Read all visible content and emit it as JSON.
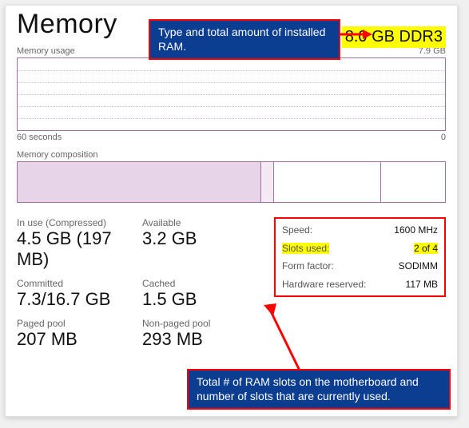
{
  "title": "Memory",
  "total_mem": "8.0 GB DDR3",
  "usage": {
    "label": "Memory usage",
    "max_label": "7.9 GB",
    "axis_left": "60 seconds",
    "axis_right": "0"
  },
  "composition": {
    "label": "Memory composition"
  },
  "stats": {
    "inuse_label": "In use (Compressed)",
    "inuse_value": "4.5 GB (197 MB)",
    "avail_label": "Available",
    "avail_value": "3.2 GB",
    "committed_label": "Committed",
    "committed_value": "7.3/16.7 GB",
    "cached_label": "Cached",
    "cached_value": "1.5 GB",
    "paged_label": "Paged pool",
    "paged_value": "207 MB",
    "nonpaged_label": "Non-paged pool",
    "nonpaged_value": "293 MB"
  },
  "specs": {
    "speed_key": "Speed:",
    "speed_val": "1600 MHz",
    "slots_key": "Slots used:",
    "slots_val": "2 of 4",
    "form_key": "Form factor:",
    "form_val": "SODIMM",
    "reserved_key": "Hardware reserved:",
    "reserved_val": "117 MB"
  },
  "callouts": {
    "top": "Type and total amount of installed RAM.",
    "bottom": "Total # of RAM slots on the motherboard and number of slots that are currently used."
  }
}
